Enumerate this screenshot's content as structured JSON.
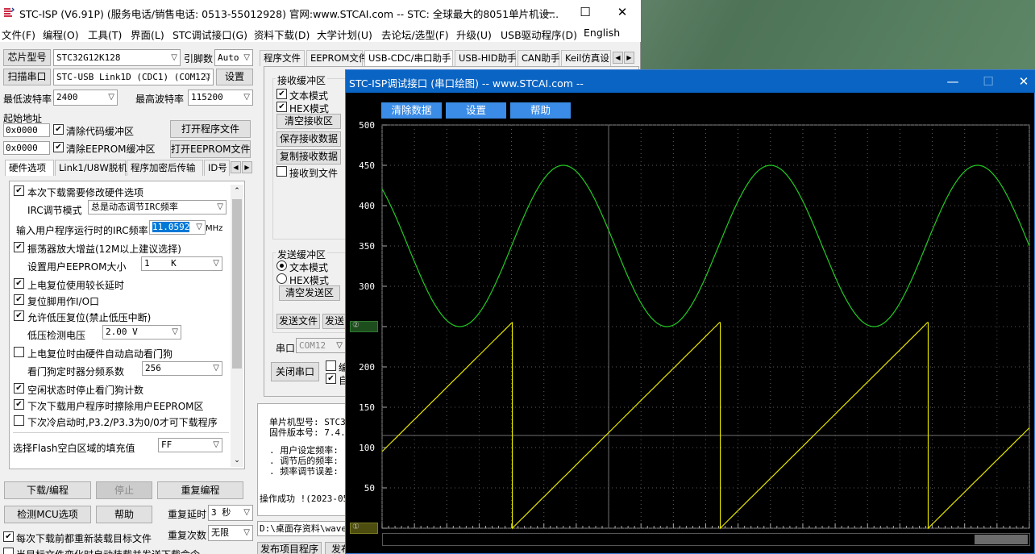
{
  "main_window": {
    "title": "STC-ISP (V6.91P) (服务电话/销售电话: 0513-55012928) 官网:www.STCAI.com  -- STC: 全球最大的8051单片机设...",
    "controls": {
      "minimize": "—",
      "maximize": "☐",
      "close": "✕"
    },
    "menu": [
      "文件(F)",
      "编程(O)",
      "工具(T)",
      "界面(L)",
      "STC调试接口(G)",
      "资料下载(D)",
      "大学计划(U)",
      "去论坛/选型(F)",
      "升级(U)",
      "USB驱动程序(D)",
      "English"
    ]
  },
  "left": {
    "chip_label": "芯片型号",
    "chip_value": "STC32G12K128",
    "pins_label": "引脚数",
    "pins_value": "Auto",
    "scan_label": "扫描串口",
    "port_value": "STC-USB Link1D (CDC1) (COM12)",
    "settings_label": "设置",
    "min_baud_label": "最低波特率",
    "min_baud_value": "2400",
    "max_baud_label": "最高波特率",
    "max_baud_value": "115200",
    "start_addr_label": "起始地址",
    "addr1": "0x0000",
    "addr2": "0x0000",
    "clear_code_label": "清除代码缓冲区",
    "clear_eeprom_label": "清除EEPROM缓冲区",
    "open_prog_label": "打开程序文件",
    "open_eeprom_label": "打开EEPROM文件",
    "tabs": [
      "硬件选项",
      "Link1/U8W脱机",
      "程序加密后传输",
      "ID号"
    ],
    "hw": {
      "opt1": "本次下载需要修改硬件选项",
      "irc_mode_label": "IRC调节模式",
      "irc_mode_value": "总是动态调节IRC频率",
      "irc_freq_label": "输入用户程序运行时的IRC频率",
      "irc_freq_value": "11.0592",
      "irc_unit": "MHz",
      "opt_osc": "振荡器放大增益(12M以上建议选择)",
      "eeprom_size_label": "设置用户EEPROM大小",
      "eeprom_size_value": "1    K",
      "opt_por": "上电复位使用较长延时",
      "opt_rst": "复位脚用作I/O口",
      "opt_lvr": "允许低压复位(禁止低压中断)",
      "lv_label": "低压检测电压",
      "lv_value": "2.00 V",
      "opt_wdt": "上电复位时由硬件自动启动看门狗",
      "wdt_div_label": "看门狗定时器分频系数",
      "wdt_div_value": "256",
      "opt_idle": "空闲状态时停止看门狗计数",
      "opt_erase": "下次下载用户程序时擦除用户EEPROM区",
      "opt_cold": "下次冷启动时,P3.2/P3.3为0/0才可下载程序",
      "flash_fill_label": "选择Flash空白区域的填充值",
      "flash_fill_value": "FF"
    },
    "download_label": "下载/编程",
    "stop_label": "停止",
    "reprogram_label": "重复编程",
    "check_mcu_label": "检测MCU选项",
    "help_label": "帮助",
    "repeat_delay_label": "重复延时",
    "repeat_delay_value": "3 秒",
    "repeat_count_label": "重复次数",
    "repeat_count_value": "无限",
    "reload_label": "每次下载前都重新装载目标文件",
    "auto_label": "当目标文件变化时自动装载并发送下载命令"
  },
  "right": {
    "tabs": [
      "程序文件",
      "EEPROM文件",
      "USB-CDC/串口助手",
      "USB-HID助手",
      "CAN助手",
      "Keil仿真设"
    ],
    "recv_buffer": "接收缓冲区",
    "text_mode": "文本模式",
    "hex_mode": "HEX模式",
    "clear_recv": "清空接收区",
    "save_recv": "保存接收数据",
    "copy_recv": "复制接收数据",
    "recv_to_file": "接收到文件",
    "send_buffer": "发送缓冲区",
    "send_text_mode": "文本模式",
    "send_hex_mode": "HEX模式",
    "clear_send": "清空发送区",
    "send_file": "发送文件",
    "send_partial": "发送",
    "port_label": "串口",
    "port_value": "COM12",
    "close_port": "关闭串口",
    "chk_a": "编",
    "chk_b": "自",
    "info_mcu": "单片机型号: STC3",
    "info_fw": "固件版本号: 7.4.",
    "info_l1": ". 用户设定频率:",
    "info_l2": ". 调节后的频率:",
    "info_l3": ". 频率调节误差:",
    "op_success": "操作成功 !(2023-05",
    "path": "D:\\桌面存资料\\wave",
    "publish": "发布项目程序",
    "publish2": "发布"
  },
  "scope": {
    "title": "STC-ISP调试接口 (串口绘图) -- www.STCAI.com --",
    "clear_label": "清除数据",
    "settings_label": "设置",
    "help_label": "帮助",
    "controls": {
      "minimize": "—",
      "maximize": "☐",
      "close": "✕"
    },
    "marker1": "②",
    "marker2": "①"
  },
  "chart_data": {
    "type": "line",
    "title": "",
    "xlabel": "",
    "ylabel": "",
    "ylim": [
      0,
      500
    ],
    "yticks": [
      500,
      450,
      400,
      350,
      300,
      250,
      200,
      150,
      100,
      50,
      0
    ],
    "background": "#000000",
    "grid": true,
    "series": [
      {
        "name": "",
        "color": "#22cc22",
        "kind": "sine",
        "center": 350,
        "amplitude": 100,
        "period_samples": 256,
        "phase_samples": -32,
        "samples": 800
      },
      {
        "name": "",
        "color": "#e6e600",
        "kind": "sawtooth",
        "min": 0,
        "max": 255,
        "period_samples": 256,
        "start_value": 95,
        "samples": 800
      }
    ]
  }
}
